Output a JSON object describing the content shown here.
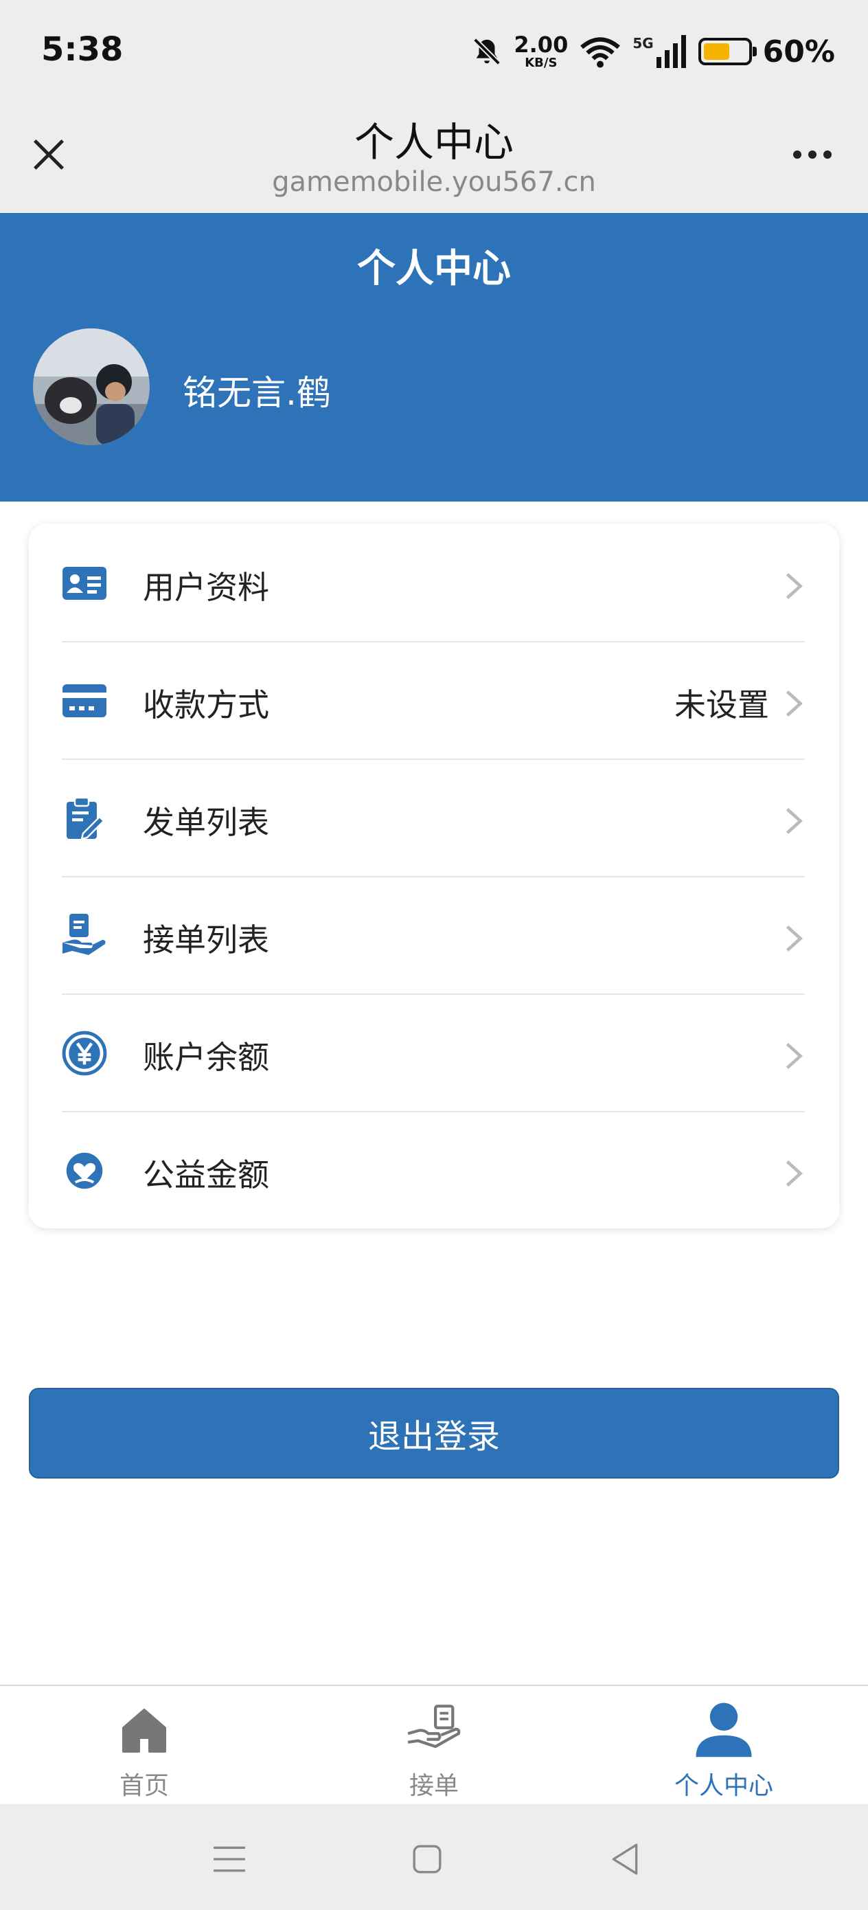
{
  "status_bar": {
    "time": "5:38",
    "net_speed_value": "2.00",
    "net_speed_unit": "KB/S",
    "network_type": "5G",
    "battery_percent": "60%",
    "battery_level": 0.6,
    "icons": [
      "mute-bell-icon",
      "wifi-icon",
      "signal-icon",
      "battery-icon"
    ]
  },
  "browser_bar": {
    "title": "个人中心",
    "url": "gamemobile.you567.cn"
  },
  "profile": {
    "header_title": "个人中心",
    "username": "铭无言.鹤"
  },
  "menu": {
    "items": [
      {
        "label": "用户资料",
        "value": "",
        "icon": "id-card-icon"
      },
      {
        "label": "收款方式",
        "value": "未设置",
        "icon": "payment-card-icon"
      },
      {
        "label": "发单列表",
        "value": "",
        "icon": "clipboard-icon"
      },
      {
        "label": "接单列表",
        "value": "",
        "icon": "hand-receive-icon"
      },
      {
        "label": "账户余额",
        "value": "",
        "icon": "yen-icon"
      },
      {
        "label": "公益金额",
        "value": "",
        "icon": "charity-heart-icon"
      }
    ]
  },
  "logout_label": "退出登录",
  "bottom_nav": {
    "items": [
      {
        "label": "首页",
        "icon": "home-icon",
        "active": false
      },
      {
        "label": "接单",
        "icon": "hand-receive-icon",
        "active": false
      },
      {
        "label": "个人中心",
        "icon": "user-icon",
        "active": true
      }
    ]
  },
  "colors": {
    "brand": "#2e72b8",
    "background": "#ffffff",
    "bar_gray": "#ededed",
    "battery": "#f5b400"
  }
}
